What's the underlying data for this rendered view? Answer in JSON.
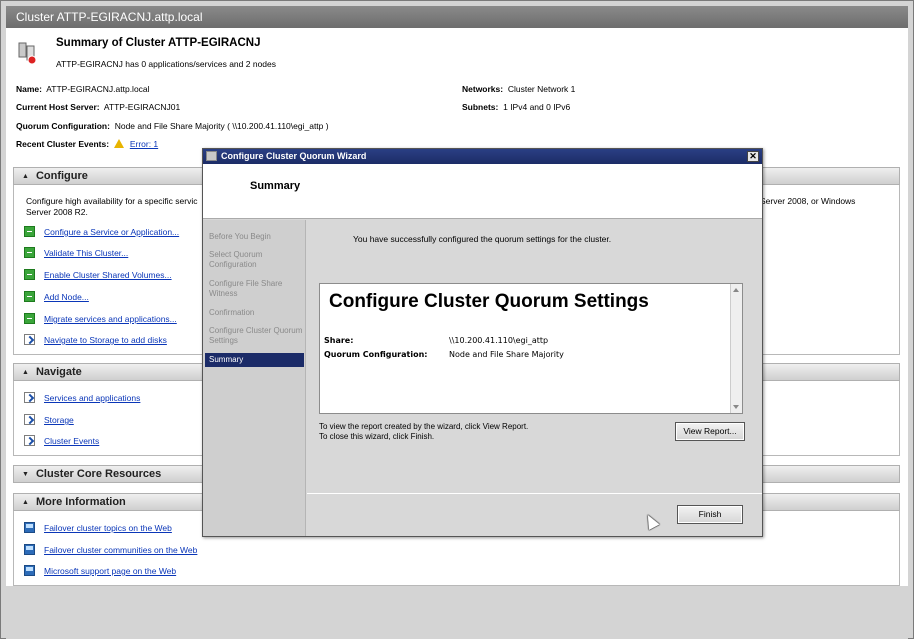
{
  "window": {
    "title": "Cluster ATTP-EGIRACNJ.attp.local"
  },
  "summary": {
    "title": "Summary of Cluster ATTP-EGIRACNJ",
    "subtitle": "ATTP-EGIRACNJ has 0 applications/services and 2 nodes"
  },
  "details": {
    "name_label": "Name:",
    "name_value": "ATTP-EGIRACNJ.attp.local",
    "host_label": "Current Host Server:",
    "host_value": "ATTP-EGIRACNJ01",
    "quorum_label": "Quorum Configuration:",
    "quorum_value": "Node and File Share Majority ( \\\\10.200.41.110\\egi_attp )",
    "events_label": "Recent Cluster Events:",
    "events_value": "Error: 1",
    "networks_label": "Networks:",
    "networks_value": "Cluster Network 1",
    "subnets_label": "Subnets:",
    "subnets_value": "1 IPv4 and 0 IPv6"
  },
  "sections": {
    "configure": {
      "title": "Configure",
      "desc_left": "Configure high availability for a specific servic",
      "desc_right": "Server 2008, or Windows",
      "desc_line2": "Server 2008 R2.",
      "items": [
        "Configure a Service or Application...",
        "Validate This Cluster...",
        "Enable Cluster Shared Volumes...",
        "Add Node...",
        "Migrate services and applications...",
        "Navigate to Storage to add disks"
      ]
    },
    "navigate": {
      "title": "Navigate",
      "items": [
        "Services and applications",
        "Storage",
        "Cluster Events"
      ]
    },
    "core": {
      "title": "Cluster Core Resources"
    },
    "more": {
      "title": "More Information",
      "items": [
        "Failover cluster topics on the Web",
        "Failover cluster communities on the Web",
        "Microsoft support page on the Web"
      ]
    }
  },
  "wizard": {
    "title": "Configure Cluster Quorum Wizard",
    "close": "✕",
    "header": "Summary",
    "steps": [
      "Before You Begin",
      "Select Quorum Configuration",
      "Configure File Share Witness",
      "Confirmation",
      "Configure Cluster Quorum Settings",
      "Summary"
    ],
    "active_step": 5,
    "success_message": "You have successfully configured the quorum settings for the cluster.",
    "report": {
      "title": "Configure Cluster Quorum Settings",
      "share_label": "Share:",
      "share_value": "\\\\10.200.41.110\\egi_attp",
      "quorum_label": "Quorum Configuration:",
      "quorum_value": "Node and File Share Majority"
    },
    "info_line1": "To view the report created by the wizard, click View Report.",
    "info_line2": "To close this wizard, click Finish.",
    "view_report_button": "View Report...",
    "finish_button": "Finish"
  },
  "colors": {
    "link": "#0a36b8",
    "wizard_title_bar": "#1c2c66",
    "warning": "#e8b400"
  },
  "icons": [
    "cluster-icon",
    "warning-icon",
    "action-arrow-icon",
    "shortcut-icon",
    "web-page-icon",
    "close-icon",
    "mouse-cursor-icon"
  ]
}
